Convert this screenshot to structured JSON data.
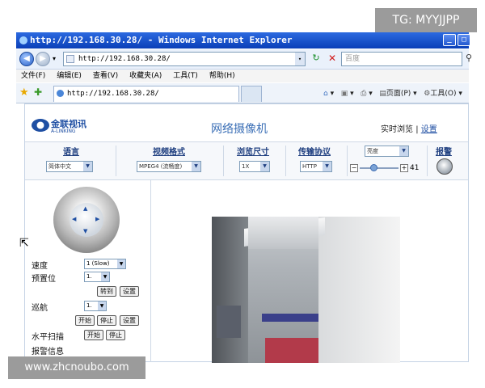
{
  "watermarks": {
    "tg": "TG: MYYJJPP",
    "site": "www.zhcnoubo.com"
  },
  "window": {
    "title": "http://192.168.30.28/ - Windows Internet Explorer"
  },
  "address": {
    "url": "http://192.168.30.28/",
    "search_placeholder": "百度"
  },
  "menu": [
    "文件(F)",
    "编辑(E)",
    "查看(V)",
    "收藏夹(A)",
    "工具(T)",
    "帮助(H)"
  ],
  "tab": {
    "label": "http://192.168.30.28/"
  },
  "toolbar_right": {
    "page": "页面(P)",
    "tools": "工具(O)"
  },
  "page": {
    "logo_text": "金联视讯",
    "logo_sub": "A-LINKING",
    "title": "网络摄像机",
    "live_view": "实时浏览",
    "separator": "|",
    "settings": "设置"
  },
  "controls": {
    "language": {
      "label": "语言",
      "value": "简体中文"
    },
    "video_format": {
      "label": "视频格式",
      "value": "MPEG4 (流畅度)"
    },
    "view_size": {
      "label": "浏览尺寸",
      "value": "1X"
    },
    "protocol": {
      "label": "传输协议",
      "value": "HTTP"
    },
    "mode": {
      "value": "亮度"
    },
    "slider": {
      "value": "41",
      "minus": "−",
      "plus": "+"
    },
    "alarm": {
      "label": "报警"
    }
  },
  "left_panel": {
    "speed": {
      "label": "速度",
      "value": "1 (Slow)"
    },
    "preset": {
      "label": "预置位",
      "value": "1.",
      "goto": "转到",
      "set": "设置"
    },
    "cruise": {
      "label": "巡航",
      "value": "1.",
      "start": "开始",
      "stop": "停止",
      "set": "设置"
    },
    "hscan": {
      "label": "水平扫描",
      "start": "开始",
      "stop": "停止"
    },
    "alarm_info": {
      "label": "报警信息"
    }
  }
}
